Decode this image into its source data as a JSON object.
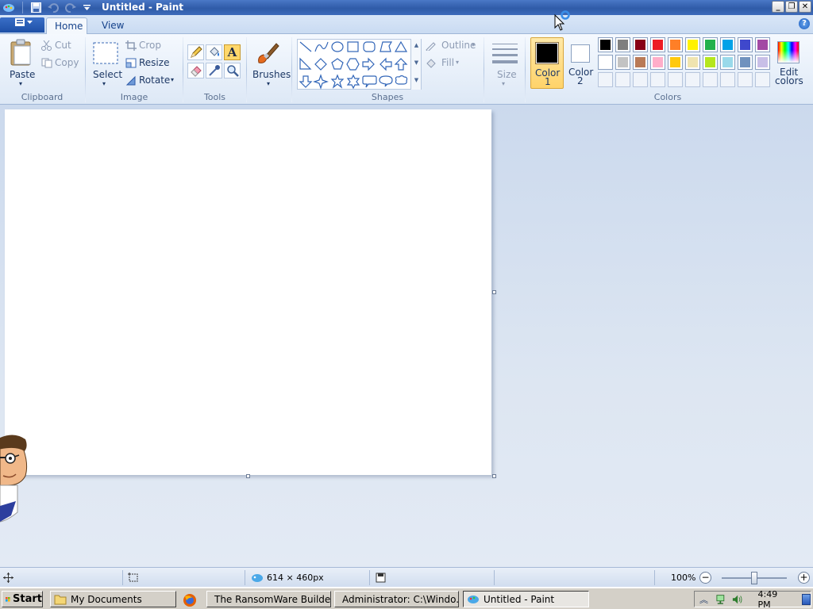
{
  "window": {
    "title": "Untitled - Paint",
    "controls": {
      "minimize": "_",
      "restore": "❐",
      "close": "✕"
    }
  },
  "tabs": [
    {
      "label": "Home",
      "active": true
    },
    {
      "label": "View",
      "active": false
    }
  ],
  "clipboard": {
    "paste": "Paste",
    "cut": "Cut",
    "copy": "Copy",
    "group": "Clipboard"
  },
  "image": {
    "select": "Select",
    "crop": "Crop",
    "resize": "Resize",
    "rotate": "Rotate",
    "group": "Image"
  },
  "tools": {
    "group": "Tools",
    "items": [
      "pencil-icon",
      "fill-icon",
      "text-icon",
      "eraser-icon",
      "color-picker-icon",
      "magnifier-icon"
    ],
    "text_glyph": "A"
  },
  "brushes": {
    "label": "Brushes"
  },
  "shapes": {
    "group": "Shapes",
    "outline": "Outline",
    "fill": "Fill",
    "items": [
      "line",
      "curve",
      "oval",
      "rectangle",
      "rounded-rectangle",
      "polygon",
      "triangle",
      "right-triangle",
      "diamond",
      "pentagon",
      "hexagon",
      "right-arrow",
      "left-arrow",
      "up-arrow",
      "down-arrow",
      "four-point-star",
      "five-point-star",
      "six-point-star",
      "rounded-callout",
      "oval-callout",
      "cloud-callout"
    ]
  },
  "size": {
    "label": "Size"
  },
  "colors": {
    "group": "Colors",
    "color1": {
      "label1": "Color",
      "label2": "1",
      "value": "#000000"
    },
    "color2": {
      "label1": "Color",
      "label2": "2",
      "value": "#ffffff"
    },
    "edit": {
      "label1": "Edit",
      "label2": "colors"
    },
    "palette_row1": [
      "#000000",
      "#7f7f7f",
      "#880015",
      "#ed1c24",
      "#ff7f27",
      "#fff200",
      "#22b14c",
      "#00a2e8",
      "#3f48cc",
      "#a349a4"
    ],
    "palette_row2": [
      "#ffffff",
      "#c3c3c3",
      "#b97a57",
      "#ffaec9",
      "#ffc90e",
      "#efe4b0",
      "#b5e61d",
      "#99d9ea",
      "#7092be",
      "#c8bfe7"
    ]
  },
  "status": {
    "dimensions": "614 × 460px",
    "zoom": "100%",
    "zoom_level": 0.5
  },
  "taskbar": {
    "start": "Start",
    "items": [
      {
        "label": "My Documents",
        "active": false
      },
      {
        "label": "The RansomWare Builder...",
        "active": false
      },
      {
        "label": "Administrator: C:\\Windo...",
        "active": false
      },
      {
        "label": "Untitled - Paint",
        "active": true
      }
    ],
    "clock": "4:49 PM"
  }
}
